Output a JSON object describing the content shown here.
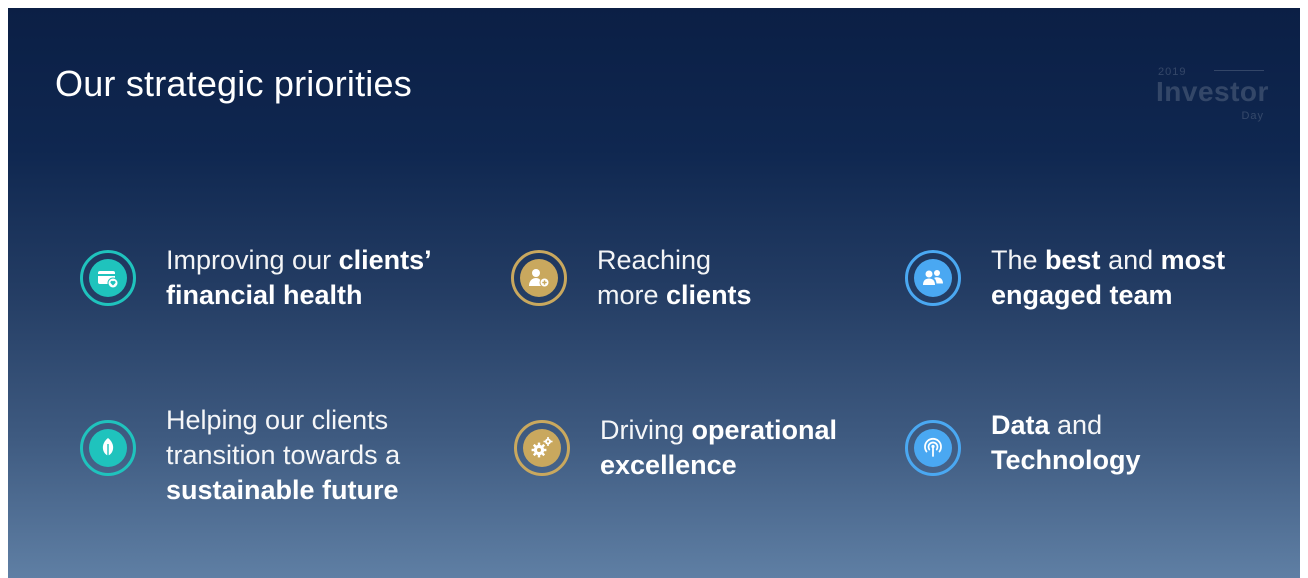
{
  "slide": {
    "title": "Our strategic priorities",
    "brand": {
      "small": "2019",
      "big": "Investor",
      "year": "Day"
    }
  },
  "priorities": [
    {
      "id": "financial-health",
      "icon": "wallet-heart-icon",
      "accent": "#1fc3bd",
      "line1_plain": "Improving our ",
      "line1_bold": "clients’",
      "line2_bold": "financial health"
    },
    {
      "id": "reach",
      "icon": "add-user-icon",
      "accent": "#c9a85e",
      "line1_plain": "Reaching",
      "line2_plain": "more ",
      "line2_bold": "clients"
    },
    {
      "id": "team",
      "icon": "team-icon",
      "accent": "#4aa8f2",
      "line1_plain": "The ",
      "line1_bold": "best",
      "line1_plain2": " and ",
      "line1_bold2": "most",
      "line2_bold": "engaged team"
    },
    {
      "id": "sustainable",
      "icon": "leaf-icon",
      "accent": "#1fc3bd",
      "line1_plain": "Helping our clients",
      "line2_plain": "transition towards a",
      "line3_bold": "sustainable future"
    },
    {
      "id": "operational",
      "icon": "gears-icon",
      "accent": "#c9a85e",
      "line1_plain": "Driving ",
      "line1_bold": "operational",
      "line2_bold": "excellence"
    },
    {
      "id": "data-tech",
      "icon": "broadcast-icon",
      "accent": "#4aa8f2",
      "line1_bold": "Data",
      "line1_plain": " and",
      "line2_bold": "Technology"
    }
  ]
}
